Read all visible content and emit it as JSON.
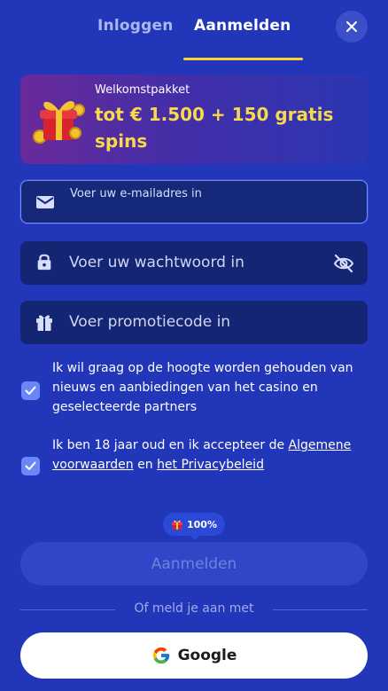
{
  "tabs": {
    "login": "Inloggen",
    "register": "Aanmelden"
  },
  "promo": {
    "label": "Welkomstpakket",
    "offer": "tot € 1.500 + 150 gratis spins"
  },
  "form": {
    "email_placeholder": "Voer uw e-mailadres in",
    "password_placeholder": "Voer uw wachtwoord in",
    "promo_placeholder": "Voer promotiecode in"
  },
  "consents": {
    "newsletter": "Ik wil graag op de hoogte worden gehouden van nieuws en aanbiedingen van het casino en geselecteerde partners",
    "terms_prefix": "Ik ben 18 jaar oud en ik accepteer de ",
    "terms_link": "Algemene voorwaarden",
    "terms_and": " en ",
    "privacy_link": "het Privacybeleid"
  },
  "progress_badge": "100%",
  "submit_label": "Aanmelden",
  "divider_text": "Of meld je aan met",
  "google_label": "Google",
  "colors": {
    "background": "#2136b8",
    "accent_yellow": "#f8d94a",
    "field_bg": "#142574",
    "checkbox": "#6a86f7"
  },
  "icons": [
    "close-icon",
    "gift-icon",
    "mail-icon",
    "lock-icon",
    "eye-off-icon",
    "check-icon",
    "google-icon"
  ]
}
